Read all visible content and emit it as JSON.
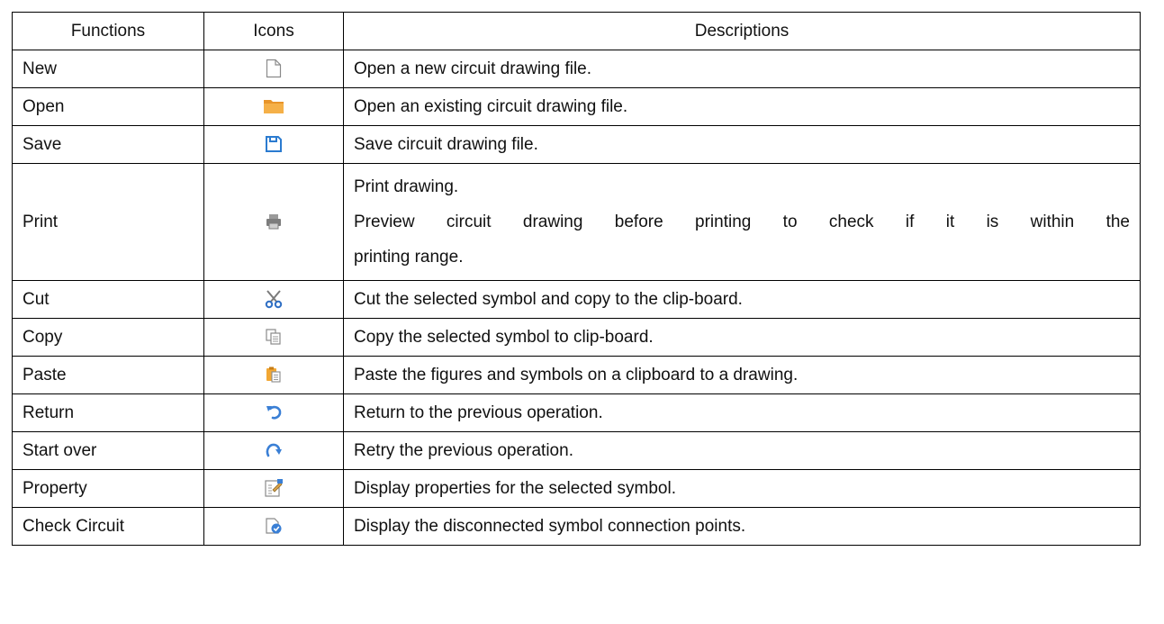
{
  "table": {
    "headers": [
      "Functions",
      "Icons",
      "Descriptions"
    ],
    "rows": [
      {
        "function": "New",
        "icon": "new-file-icon",
        "description": [
          "Open a new circuit drawing file."
        ]
      },
      {
        "function": "Open",
        "icon": "open-folder-icon",
        "description": [
          "Open an existing circuit drawing file."
        ]
      },
      {
        "function": "Save",
        "icon": "save-disk-icon",
        "description": [
          "Save circuit drawing file."
        ]
      },
      {
        "function": "Print",
        "icon": "printer-icon",
        "description": [
          "Print drawing.",
          "Preview circuit drawing before printing to check if it is within the",
          "printing range."
        ]
      },
      {
        "function": "Cut",
        "icon": "scissors-icon",
        "description": [
          "Cut the selected symbol and copy to the clip-board."
        ]
      },
      {
        "function": "Copy",
        "icon": "copy-icon",
        "description": [
          "Copy the selected symbol to clip-board."
        ]
      },
      {
        "function": "Paste",
        "icon": "paste-icon",
        "description": [
          "Paste the figures and symbols on a clipboard to a drawing."
        ]
      },
      {
        "function": "Return",
        "icon": "undo-icon",
        "description": [
          "Return to the previous operation."
        ]
      },
      {
        "function": "Start over",
        "icon": "redo-icon",
        "description": [
          "Retry the previous operation."
        ]
      },
      {
        "function": "Property",
        "icon": "property-icon",
        "description": [
          "Display properties for the selected symbol."
        ]
      },
      {
        "function": "Check Circuit",
        "icon": "check-circuit-icon",
        "description": [
          "Display the disconnected symbol connection points."
        ]
      }
    ]
  },
  "colors": {
    "border": "#000000",
    "text": "#111111",
    "folder": "#f0a030",
    "save_blue": "#2b7bd0",
    "icon_gray": "#8a8a8a",
    "icon_blue": "#3a7fd5"
  }
}
